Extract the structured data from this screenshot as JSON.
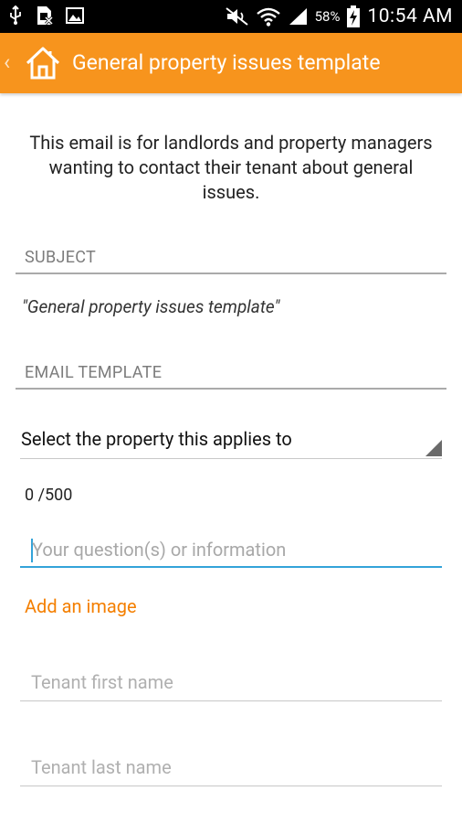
{
  "status_bar": {
    "time": "10:54 AM",
    "battery_percent": "58%",
    "icons": [
      "usb-icon",
      "sim-card-icon",
      "gallery-icon",
      "mute-icon",
      "wifi-icon",
      "signal-icon",
      "battery-charging-icon"
    ]
  },
  "app_bar": {
    "title": "General property issues template",
    "background_color": "#f7941d"
  },
  "intro_text": "This email is for landlords and property managers wanting to contact their tenant about general issues.",
  "subject_section": {
    "header": "SUBJECT",
    "value": "\"General property issues template\""
  },
  "template_section": {
    "header": "EMAIL TEMPLATE"
  },
  "property_select": {
    "selected": "Select the property this applies to"
  },
  "char_counter": "0 /500",
  "question_input": {
    "value": "",
    "placeholder": "Your question(s) or information"
  },
  "add_image_link": "Add an image",
  "tenant_first_name": {
    "value": "",
    "placeholder": "Tenant first name"
  },
  "tenant_last_name": {
    "value": "",
    "placeholder": "Tenant last name"
  },
  "colors": {
    "accent": "#f47f00",
    "focus_line": "#33a3d9"
  }
}
